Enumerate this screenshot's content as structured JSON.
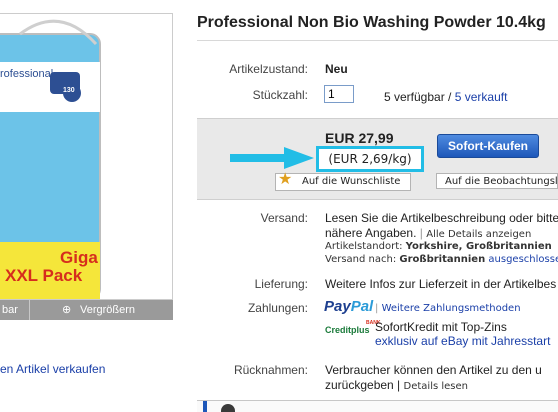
{
  "product": {
    "title": "Professional Non Bio Washing Powder 10.4kg",
    "image_brand_text": "rofessional",
    "image_number": "130",
    "image_giga": "Giga",
    "image_pack": "XXL Pack"
  },
  "gallery": {
    "prev_label": "bar",
    "zoom_label": "Vergrößern"
  },
  "sell_link": "en Artikel verkaufen",
  "details": {
    "condition_label": "Artikelzustand:",
    "condition_value": "Neu",
    "quantity_label": "Stückzahl:",
    "quantity_value": "1",
    "available_text": "5 verfügbar /",
    "sold_link": "5 verkauft"
  },
  "buy": {
    "price": "EUR 27,99",
    "unit_price": "(EUR 2,69/kg)",
    "buy_now": "Sofort-Kaufen",
    "wishlist": "Auf die Wunschliste",
    "watchlist": "Auf die Beobachtungsliste"
  },
  "shipping": {
    "label": "Versand:",
    "text1": "Lesen Sie die Artikelbeschreibung oder bitten",
    "text2": "nähere Angaben.",
    "details_link": "Alle Details anzeigen",
    "location_label": "Artikelstandort:",
    "location_value": "Yorkshire, Großbritannien",
    "shipto_label": "Versand nach:",
    "shipto_value": "Großbritannien",
    "shipto_rest": "ausgeschlossen"
  },
  "delivery": {
    "label": "Lieferung:",
    "text": "Weitere Infos zur Lieferzeit in der Artikelbes"
  },
  "payment": {
    "label": "Zahlungen:",
    "paypal_a": "Pay",
    "paypal_b": "Pal",
    "more_methods": "Weitere Zahlungsmethoden",
    "credit_logo": "Creditplus",
    "credit_logo_tag": "BANK",
    "credit_title": "SofortKredit mit Top-Zins",
    "credit_link": "exklusiv auf eBay mit Jahresstart"
  },
  "returns": {
    "label": "Rücknahmen:",
    "text1": "Verbraucher können den Artikel zu den u",
    "text2": "zurückgeben |",
    "details_link": "Details lesen"
  },
  "colors": {
    "highlight": "#22bde6",
    "link": "#1a3fa8",
    "buy_button": "#1d57b9"
  }
}
